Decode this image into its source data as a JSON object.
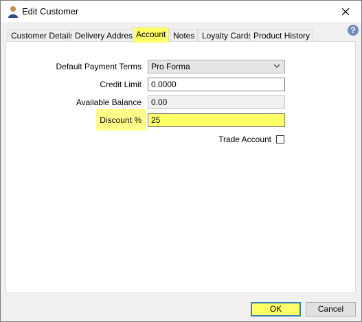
{
  "window": {
    "title": "Edit Customer",
    "help": "?"
  },
  "tabs": [
    {
      "label": "Customer Details",
      "active": false
    },
    {
      "label": "Delivery Address",
      "active": false
    },
    {
      "label": "Account",
      "active": true
    },
    {
      "label": "Notes",
      "active": false
    },
    {
      "label": "Loyalty Cards",
      "active": false
    },
    {
      "label": "Product History",
      "active": false
    }
  ],
  "form": {
    "payment_terms": {
      "label": "Default Payment Terms",
      "value": "Pro Forma"
    },
    "credit_limit": {
      "label": "Credit Limit",
      "value": "0.0000"
    },
    "available_balance": {
      "label": "Available Balance",
      "value": "0.00"
    },
    "discount": {
      "label": "Discount %",
      "value": "25"
    },
    "trade_account": {
      "label": "Trade Account",
      "checked": false
    }
  },
  "buttons": {
    "ok": "OK",
    "cancel": "Cancel"
  },
  "colors": {
    "highlight": "#ffff66",
    "accent": "#3c7fb1"
  }
}
